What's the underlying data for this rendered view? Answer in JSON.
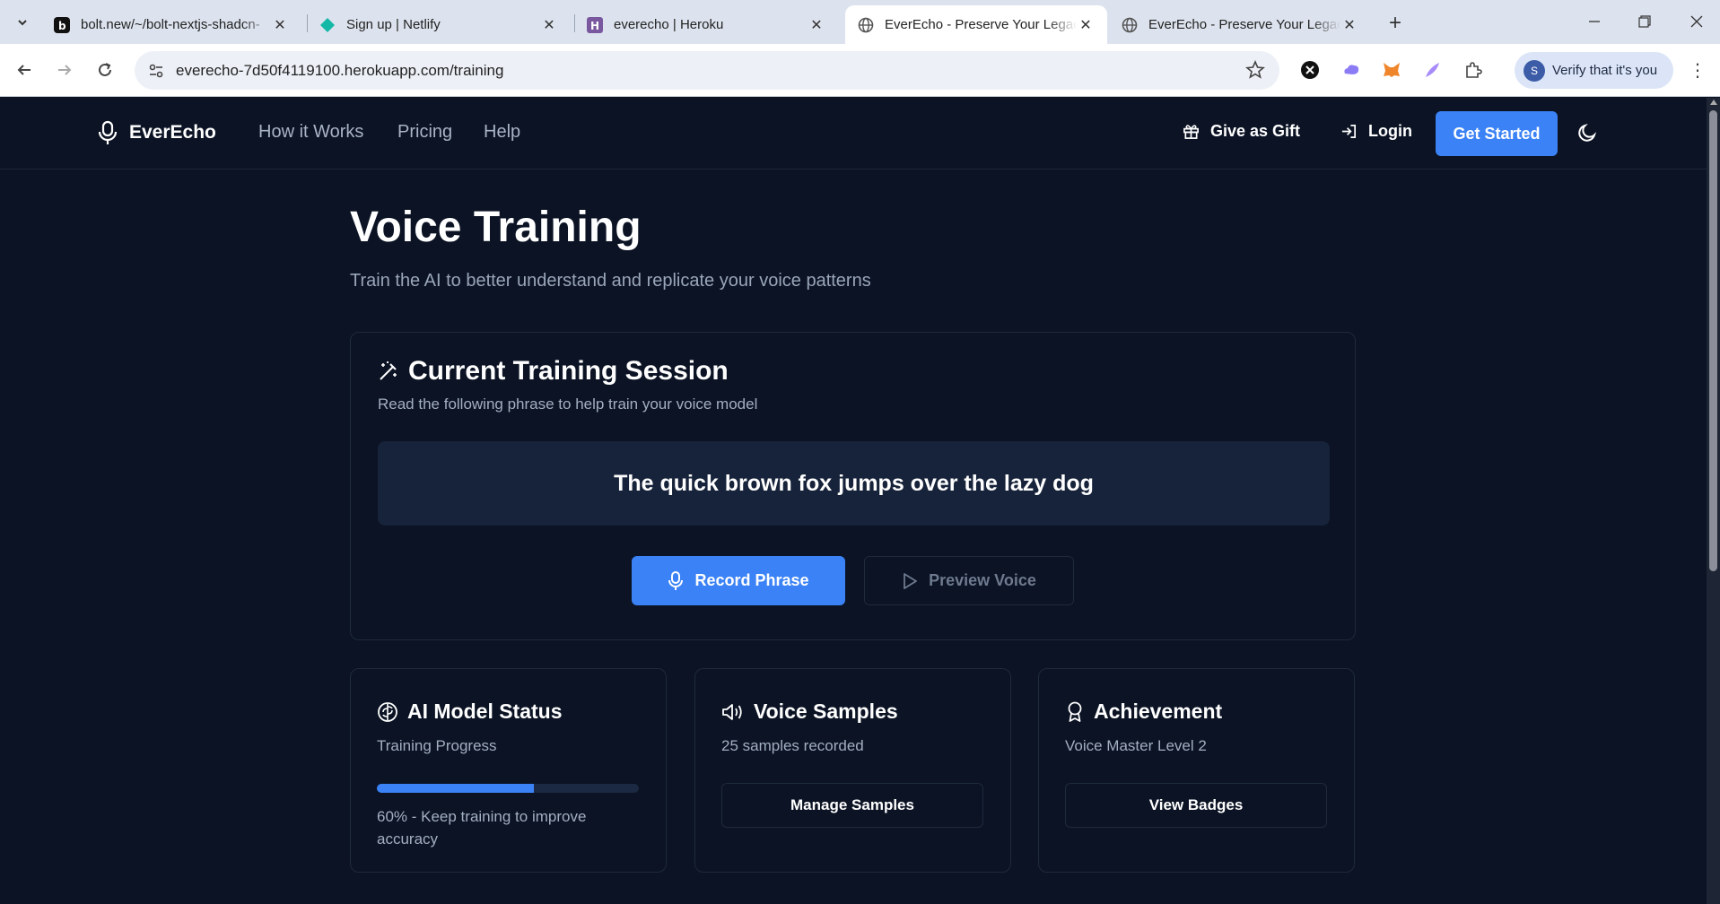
{
  "browser": {
    "tabs": [
      {
        "title": "bolt.new/~/bolt-nextjs-shadcn-",
        "icon": "bolt-icon"
      },
      {
        "title": "Sign up | Netlify",
        "icon": "netlify-icon"
      },
      {
        "title": "everecho | Heroku",
        "icon": "heroku-icon"
      },
      {
        "title": "EverEcho - Preserve Your Legacy",
        "icon": "globe-icon",
        "active": true
      },
      {
        "title": "EverEcho - Preserve Your Legacy",
        "icon": "globe-icon"
      }
    ],
    "url": "everecho-7d50f4119100.herokuapp.com/training",
    "verify_label": "Verify that it's you"
  },
  "site": {
    "brand": "EverEcho",
    "nav": {
      "how_it_works": "How it Works",
      "pricing": "Pricing",
      "help": "Help",
      "gift": "Give as Gift",
      "login": "Login",
      "get_started": "Get Started"
    },
    "accent_color": "#3b82f6"
  },
  "main": {
    "title": "Voice Training",
    "subtitle": "Train the AI to better understand and replicate your voice patterns",
    "session": {
      "title": "Current Training Session",
      "description": "Read the following phrase to help train your voice model",
      "phrase": "The quick brown fox jumps over the lazy dog",
      "record_label": "Record Phrase",
      "preview_label": "Preview Voice"
    },
    "cards": {
      "model": {
        "title": "AI Model Status",
        "subtitle": "Training Progress",
        "progress_percent": 60,
        "progress_text": "60% - Keep training to improve accuracy"
      },
      "samples": {
        "title": "Voice Samples",
        "subtitle": "25 samples recorded",
        "button": "Manage Samples"
      },
      "achievement": {
        "title": "Achievement",
        "subtitle": "Voice Master Level 2",
        "button": "View Badges"
      }
    }
  }
}
